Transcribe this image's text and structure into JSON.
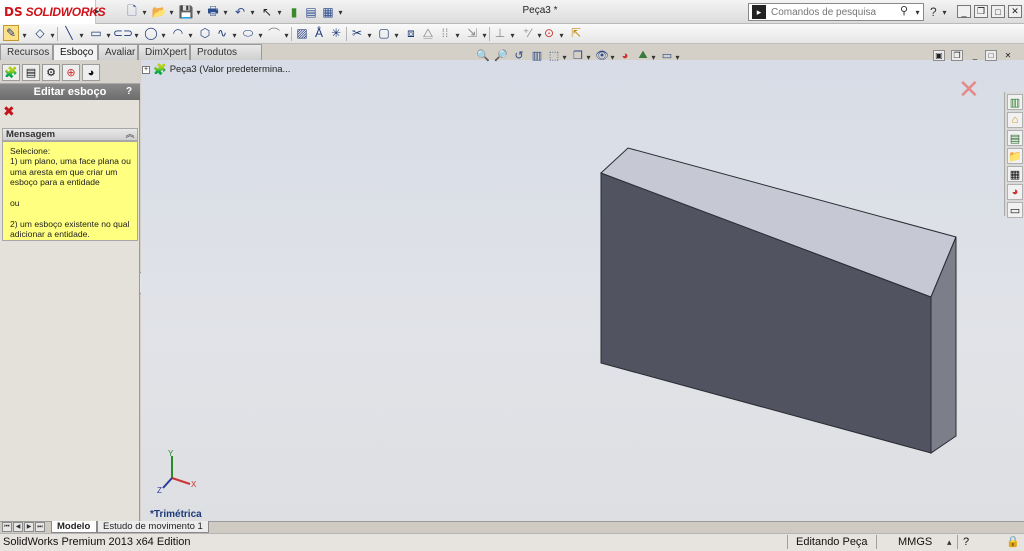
{
  "app": {
    "logo_prefix": "DS",
    "logo_text": "SOLIDWORKS",
    "document_title": "Peça3 *",
    "search_placeholder": "Comandos de pesquisa",
    "help_label": "?"
  },
  "tabs": [
    "Recursos",
    "Esboço",
    "Avaliar",
    "DimXpert",
    "Produtos Office"
  ],
  "active_tab": "Esboço",
  "feature_tree": {
    "root_label": "Peça3  (Valor predetermina..."
  },
  "property_manager": {
    "title": "Editar esboço",
    "help": "?",
    "cancel_glyph": "✖",
    "message_section_title": "Mensagem",
    "message_collapse": "︽",
    "message_text": "Selecione:\n 1) um plano, uma face plana ou uma aresta em que criar um esboço para a entidade\n\nou\n\n2) um esboço existente no qual adicionar a entidade."
  },
  "viewport": {
    "view_orientation": "*Trimétrica",
    "triad": {
      "x": "X",
      "y": "Y",
      "z": "Z"
    },
    "close_sketch_glyph": "✕"
  },
  "bottom_tabs": [
    "Modelo",
    "Estudo de movimento 1"
  ],
  "active_bottom_tab": "Modelo",
  "status": {
    "edition": "SolidWorks Premium 2013 x64 Edition",
    "mode": "Editando Peça",
    "units": "MMGS",
    "help_glyph": "?"
  },
  "colors": {
    "viewport_bg": "#dcdfe4",
    "box_front": "#515360",
    "box_top": "#c6c8d4",
    "box_side": "#7c7e8a",
    "message_bg": "#ffff80",
    "brand_red": "#d0121b"
  }
}
